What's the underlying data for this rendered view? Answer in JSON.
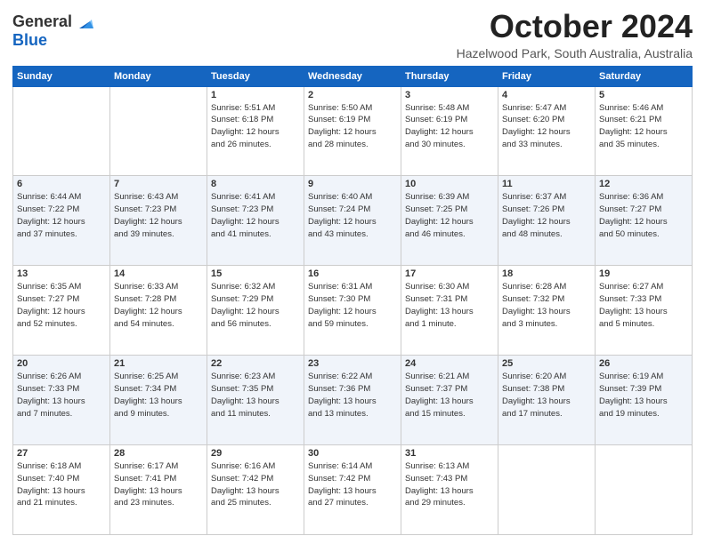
{
  "header": {
    "logo_general": "General",
    "logo_blue": "Blue",
    "month_title": "October 2024",
    "location": "Hazelwood Park, South Australia, Australia"
  },
  "days_of_week": [
    "Sunday",
    "Monday",
    "Tuesday",
    "Wednesday",
    "Thursday",
    "Friday",
    "Saturday"
  ],
  "weeks": [
    [
      {
        "day": "",
        "info": ""
      },
      {
        "day": "",
        "info": ""
      },
      {
        "day": "1",
        "info": "Sunrise: 5:51 AM\nSunset: 6:18 PM\nDaylight: 12 hours\nand 26 minutes."
      },
      {
        "day": "2",
        "info": "Sunrise: 5:50 AM\nSunset: 6:19 PM\nDaylight: 12 hours\nand 28 minutes."
      },
      {
        "day": "3",
        "info": "Sunrise: 5:48 AM\nSunset: 6:19 PM\nDaylight: 12 hours\nand 30 minutes."
      },
      {
        "day": "4",
        "info": "Sunrise: 5:47 AM\nSunset: 6:20 PM\nDaylight: 12 hours\nand 33 minutes."
      },
      {
        "day": "5",
        "info": "Sunrise: 5:46 AM\nSunset: 6:21 PM\nDaylight: 12 hours\nand 35 minutes."
      }
    ],
    [
      {
        "day": "6",
        "info": "Sunrise: 6:44 AM\nSunset: 7:22 PM\nDaylight: 12 hours\nand 37 minutes."
      },
      {
        "day": "7",
        "info": "Sunrise: 6:43 AM\nSunset: 7:23 PM\nDaylight: 12 hours\nand 39 minutes."
      },
      {
        "day": "8",
        "info": "Sunrise: 6:41 AM\nSunset: 7:23 PM\nDaylight: 12 hours\nand 41 minutes."
      },
      {
        "day": "9",
        "info": "Sunrise: 6:40 AM\nSunset: 7:24 PM\nDaylight: 12 hours\nand 43 minutes."
      },
      {
        "day": "10",
        "info": "Sunrise: 6:39 AM\nSunset: 7:25 PM\nDaylight: 12 hours\nand 46 minutes."
      },
      {
        "day": "11",
        "info": "Sunrise: 6:37 AM\nSunset: 7:26 PM\nDaylight: 12 hours\nand 48 minutes."
      },
      {
        "day": "12",
        "info": "Sunrise: 6:36 AM\nSunset: 7:27 PM\nDaylight: 12 hours\nand 50 minutes."
      }
    ],
    [
      {
        "day": "13",
        "info": "Sunrise: 6:35 AM\nSunset: 7:27 PM\nDaylight: 12 hours\nand 52 minutes."
      },
      {
        "day": "14",
        "info": "Sunrise: 6:33 AM\nSunset: 7:28 PM\nDaylight: 12 hours\nand 54 minutes."
      },
      {
        "day": "15",
        "info": "Sunrise: 6:32 AM\nSunset: 7:29 PM\nDaylight: 12 hours\nand 56 minutes."
      },
      {
        "day": "16",
        "info": "Sunrise: 6:31 AM\nSunset: 7:30 PM\nDaylight: 12 hours\nand 59 minutes."
      },
      {
        "day": "17",
        "info": "Sunrise: 6:30 AM\nSunset: 7:31 PM\nDaylight: 13 hours\nand 1 minute."
      },
      {
        "day": "18",
        "info": "Sunrise: 6:28 AM\nSunset: 7:32 PM\nDaylight: 13 hours\nand 3 minutes."
      },
      {
        "day": "19",
        "info": "Sunrise: 6:27 AM\nSunset: 7:33 PM\nDaylight: 13 hours\nand 5 minutes."
      }
    ],
    [
      {
        "day": "20",
        "info": "Sunrise: 6:26 AM\nSunset: 7:33 PM\nDaylight: 13 hours\nand 7 minutes."
      },
      {
        "day": "21",
        "info": "Sunrise: 6:25 AM\nSunset: 7:34 PM\nDaylight: 13 hours\nand 9 minutes."
      },
      {
        "day": "22",
        "info": "Sunrise: 6:23 AM\nSunset: 7:35 PM\nDaylight: 13 hours\nand 11 minutes."
      },
      {
        "day": "23",
        "info": "Sunrise: 6:22 AM\nSunset: 7:36 PM\nDaylight: 13 hours\nand 13 minutes."
      },
      {
        "day": "24",
        "info": "Sunrise: 6:21 AM\nSunset: 7:37 PM\nDaylight: 13 hours\nand 15 minutes."
      },
      {
        "day": "25",
        "info": "Sunrise: 6:20 AM\nSunset: 7:38 PM\nDaylight: 13 hours\nand 17 minutes."
      },
      {
        "day": "26",
        "info": "Sunrise: 6:19 AM\nSunset: 7:39 PM\nDaylight: 13 hours\nand 19 minutes."
      }
    ],
    [
      {
        "day": "27",
        "info": "Sunrise: 6:18 AM\nSunset: 7:40 PM\nDaylight: 13 hours\nand 21 minutes."
      },
      {
        "day": "28",
        "info": "Sunrise: 6:17 AM\nSunset: 7:41 PM\nDaylight: 13 hours\nand 23 minutes."
      },
      {
        "day": "29",
        "info": "Sunrise: 6:16 AM\nSunset: 7:42 PM\nDaylight: 13 hours\nand 25 minutes."
      },
      {
        "day": "30",
        "info": "Sunrise: 6:14 AM\nSunset: 7:42 PM\nDaylight: 13 hours\nand 27 minutes."
      },
      {
        "day": "31",
        "info": "Sunrise: 6:13 AM\nSunset: 7:43 PM\nDaylight: 13 hours\nand 29 minutes."
      },
      {
        "day": "",
        "info": ""
      },
      {
        "day": "",
        "info": ""
      }
    ]
  ]
}
